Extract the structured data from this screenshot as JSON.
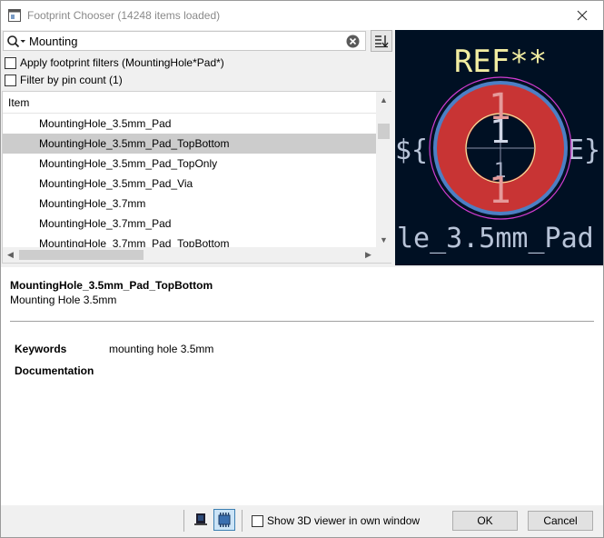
{
  "window": {
    "title": "Footprint Chooser (14248 items loaded)"
  },
  "search": {
    "value": "Mounting",
    "placeholder": ""
  },
  "filters": {
    "footprint_filter_label": "Apply footprint filters (MountingHole*Pad*)",
    "pin_count_label": "Filter by pin count (1)"
  },
  "list": {
    "header": "Item",
    "items": [
      "MountingHole_3.5mm_Pad",
      "MountingHole_3.5mm_Pad_TopBottom",
      "MountingHole_3.5mm_Pad_TopOnly",
      "MountingHole_3.5mm_Pad_Via",
      "MountingHole_3.7mm",
      "MountingHole_3.7mm_Pad",
      "MountingHole_3.7mm_Pad_TopBottom"
    ],
    "selected_index": 1
  },
  "preview": {
    "ref_text": "REF**",
    "pad_number": "1",
    "value_text": "le_3.5mm_Pad",
    "left_fragment": "${",
    "right_fragment": "E}",
    "colors": {
      "background": "#001023",
      "pad": "#c83434",
      "ring": "#4d7fc4",
      "courtyard": "#d23cd2",
      "silk": "#f2eda1",
      "hole": "#001023"
    }
  },
  "details": {
    "name": "MountingHole_3.5mm_Pad_TopBottom",
    "description": "Mounting Hole 3.5mm",
    "keywords_label": "Keywords",
    "keywords_value": "mounting hole 3.5mm",
    "documentation_label": "Documentation"
  },
  "footer": {
    "show3d_label": "Show 3D viewer in own window",
    "ok_label": "OK",
    "cancel_label": "Cancel"
  }
}
